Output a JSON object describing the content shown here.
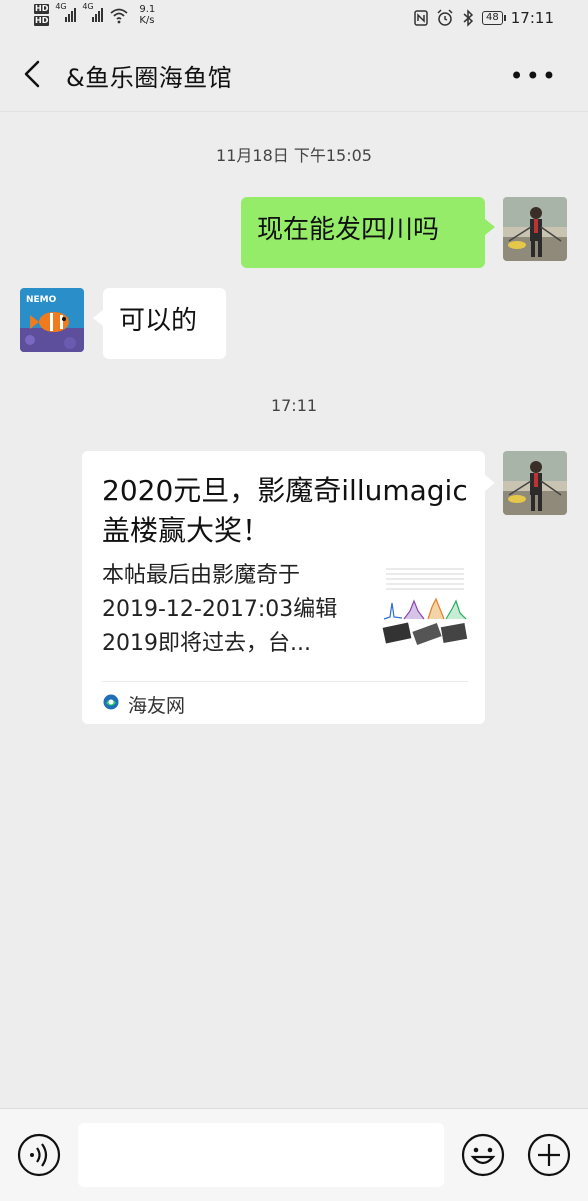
{
  "status_bar": {
    "hd1": "HD",
    "hd2": "HD",
    "net1": "4G",
    "net2": "4G",
    "speed_value": "9.1",
    "speed_unit": "K/s",
    "battery": "48",
    "time": "17:11"
  },
  "header": {
    "title": "&鱼乐圈海鱼馆",
    "more_label": "•••"
  },
  "messages": {
    "time1": "11月18日 下午15:05",
    "msg1": "现在能发四川吗",
    "msg2": "可以的",
    "time2": "17:11",
    "card": {
      "title": "2020元旦，影魔奇illumagic盖楼赢大奖！",
      "desc": "本帖最后由影魔奇于2019-12-2017:03编辑2019即将过去，台...",
      "source": "海友网"
    }
  },
  "contact_avatar": {
    "brand_text": "NEMO"
  },
  "input": {
    "placeholder": ""
  },
  "colors": {
    "background": "#ededed",
    "my_bubble": "#95ec69",
    "other_bubble": "#ffffff"
  }
}
